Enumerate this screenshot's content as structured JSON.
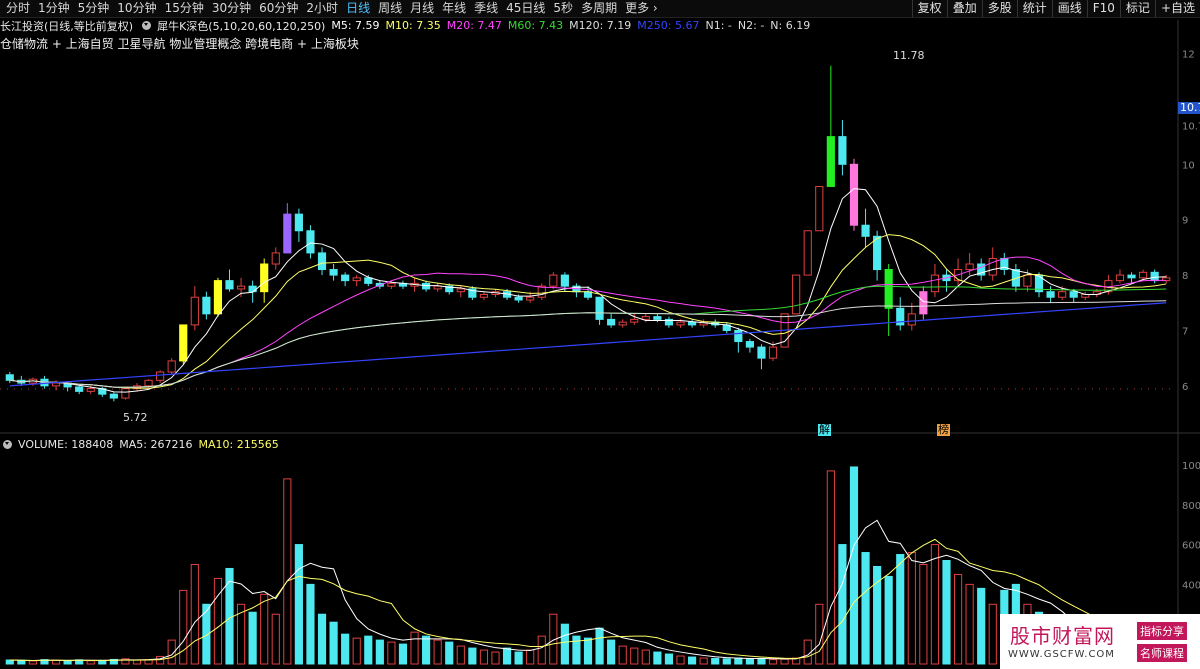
{
  "toolbar": {
    "periods": [
      "分时",
      "1分钟",
      "5分钟",
      "10分钟",
      "15分钟",
      "30分钟",
      "60分钟",
      "2小时",
      "日线",
      "周线",
      "月线",
      "年线",
      "季线",
      "45日线",
      "5秒",
      "多周期",
      "更多"
    ],
    "active_period": "日线",
    "right_buttons": [
      "复权",
      "叠加",
      "多股",
      "统计",
      "画线",
      "F10",
      "标记",
      "+自选"
    ]
  },
  "header": {
    "stock_title": "长江投资(日线,等比前复权)",
    "indicator_name": "犀牛K深色(5,10,20,60,120,250)",
    "ma5": "M5: 7.59",
    "ma10": "M10: 7.35",
    "ma20": "M20: 7.47",
    "ma60": "M60: 7.43",
    "ma120": "M120: 7.19",
    "ma250": "M250: 5.67",
    "n1": "N1: -",
    "n2": "N2: -",
    "n": "N: 6.19"
  },
  "concepts": "仓储物流 + 上海自贸 卫星导航 物业管理概念 跨境电商 + 上海板块",
  "chart_annotations": {
    "high_label": "11.78",
    "low_label": "5.72",
    "marker_1": "解",
    "marker_2": "榜",
    "right_price_tag": "10.7"
  },
  "volume_header": {
    "volume": "VOLUME: 188408",
    "ma5": "MA5: 267216",
    "ma10": "MA10: 215565"
  },
  "watermark": {
    "title": "股市财富网",
    "url": "WWW.GSCFW.COM",
    "tag1": "指标分享",
    "tag2": "名师课程"
  },
  "colors": {
    "up": "#e04040",
    "down": "#4ee8f0",
    "ma5": "#ffffff",
    "ma10": "#ffff66",
    "ma20": "#ff44ff",
    "ma60": "#33dd33",
    "ma120": "#dddddd",
    "ma250": "#3344ff",
    "signal_yellow": "#ffff22",
    "signal_purple": "#9966ff",
    "signal_pink": "#ff77dd",
    "signal_green": "#22ee22"
  },
  "right_axis_price": [
    "12",
    "11",
    "10.7",
    "10",
    "9",
    "8",
    "7",
    "6"
  ],
  "right_axis_volume": [
    "1000",
    "800",
    "600",
    "400",
    "200"
  ],
  "chart_data": {
    "type": "candlestick",
    "candles": [
      {
        "o": 6.2,
        "c": 6.1,
        "h": 6.25,
        "l": 6.05,
        "vol": 20000
      },
      {
        "o": 6.1,
        "c": 6.05,
        "h": 6.18,
        "l": 6.0,
        "vol": 18000
      },
      {
        "o": 6.05,
        "c": 6.12,
        "h": 6.15,
        "l": 6.0,
        "vol": 15000
      },
      {
        "o": 6.12,
        "c": 6.0,
        "h": 6.18,
        "l": 5.95,
        "vol": 22000
      },
      {
        "o": 6.0,
        "c": 6.05,
        "h": 6.1,
        "l": 5.92,
        "vol": 19000
      },
      {
        "o": 6.05,
        "c": 5.98,
        "h": 6.08,
        "l": 5.9,
        "vol": 17000
      },
      {
        "o": 5.98,
        "c": 5.9,
        "h": 6.0,
        "l": 5.85,
        "vol": 21000
      },
      {
        "o": 5.9,
        "c": 5.95,
        "h": 6.0,
        "l": 5.85,
        "vol": 16000
      },
      {
        "o": 5.95,
        "c": 5.85,
        "h": 5.98,
        "l": 5.8,
        "vol": 18000
      },
      {
        "o": 5.85,
        "c": 5.78,
        "h": 5.88,
        "l": 5.72,
        "vol": 23000
      },
      {
        "o": 5.78,
        "c": 5.95,
        "h": 5.98,
        "l": 5.75,
        "vol": 26000
      },
      {
        "o": 5.95,
        "c": 6.0,
        "h": 6.05,
        "l": 5.9,
        "vol": 20000
      },
      {
        "o": 6.0,
        "c": 6.1,
        "h": 6.12,
        "l": 5.96,
        "vol": 22000
      },
      {
        "o": 6.1,
        "c": 6.25,
        "h": 6.28,
        "l": 6.05,
        "vol": 38000
      },
      {
        "o": 6.25,
        "c": 6.45,
        "h": 6.5,
        "l": 6.2,
        "vol": 120000
      },
      {
        "o": 6.45,
        "c": 7.1,
        "h": 7.1,
        "l": 6.4,
        "vol": 370000,
        "sig": "yellow"
      },
      {
        "o": 7.1,
        "c": 7.6,
        "h": 7.8,
        "l": 7.0,
        "vol": 500000
      },
      {
        "o": 7.6,
        "c": 7.3,
        "h": 7.7,
        "l": 7.2,
        "vol": 300000
      },
      {
        "o": 7.3,
        "c": 7.9,
        "h": 7.95,
        "l": 7.25,
        "vol": 430000,
        "sig": "yellow"
      },
      {
        "o": 7.9,
        "c": 7.75,
        "h": 8.1,
        "l": 7.7,
        "vol": 480000
      },
      {
        "o": 7.75,
        "c": 7.8,
        "h": 7.95,
        "l": 7.6,
        "vol": 300000
      },
      {
        "o": 7.8,
        "c": 7.7,
        "h": 7.9,
        "l": 7.5,
        "vol": 260000
      },
      {
        "o": 7.7,
        "c": 8.2,
        "h": 8.3,
        "l": 7.5,
        "vol": 350000,
        "sig": "yellow"
      },
      {
        "o": 8.2,
        "c": 8.4,
        "h": 8.5,
        "l": 8.1,
        "vol": 250000
      },
      {
        "o": 8.4,
        "c": 9.1,
        "h": 9.3,
        "l": 8.4,
        "vol": 930000,
        "sig": "purple"
      },
      {
        "o": 9.1,
        "c": 8.8,
        "h": 9.2,
        "l": 8.6,
        "vol": 600000
      },
      {
        "o": 8.8,
        "c": 8.4,
        "h": 8.9,
        "l": 8.3,
        "vol": 400000
      },
      {
        "o": 8.4,
        "c": 8.1,
        "h": 8.5,
        "l": 8.0,
        "vol": 250000
      },
      {
        "o": 8.1,
        "c": 8.0,
        "h": 8.2,
        "l": 7.9,
        "vol": 210000
      },
      {
        "o": 8.0,
        "c": 7.9,
        "h": 8.05,
        "l": 7.8,
        "vol": 150000
      },
      {
        "o": 7.9,
        "c": 7.95,
        "h": 8.0,
        "l": 7.8,
        "vol": 130000
      },
      {
        "o": 7.95,
        "c": 7.85,
        "h": 8.0,
        "l": 7.8,
        "vol": 140000
      },
      {
        "o": 7.85,
        "c": 7.8,
        "h": 7.9,
        "l": 7.75,
        "vol": 120000
      },
      {
        "o": 7.8,
        "c": 7.85,
        "h": 7.9,
        "l": 7.75,
        "vol": 110000
      },
      {
        "o": 7.85,
        "c": 7.8,
        "h": 7.9,
        "l": 7.75,
        "vol": 100000
      },
      {
        "o": 7.8,
        "c": 7.85,
        "h": 7.95,
        "l": 7.7,
        "vol": 160000
      },
      {
        "o": 7.85,
        "c": 7.75,
        "h": 7.9,
        "l": 7.7,
        "vol": 140000
      },
      {
        "o": 7.75,
        "c": 7.8,
        "h": 7.85,
        "l": 7.7,
        "vol": 120000
      },
      {
        "o": 7.8,
        "c": 7.7,
        "h": 7.85,
        "l": 7.65,
        "vol": 110000
      },
      {
        "o": 7.7,
        "c": 7.75,
        "h": 7.8,
        "l": 7.6,
        "vol": 90000
      },
      {
        "o": 7.75,
        "c": 7.6,
        "h": 7.8,
        "l": 7.55,
        "vol": 80000
      },
      {
        "o": 7.6,
        "c": 7.65,
        "h": 7.7,
        "l": 7.55,
        "vol": 70000
      },
      {
        "o": 7.65,
        "c": 7.7,
        "h": 7.75,
        "l": 7.6,
        "vol": 60000
      },
      {
        "o": 7.7,
        "c": 7.6,
        "h": 7.75,
        "l": 7.55,
        "vol": 80000
      },
      {
        "o": 7.6,
        "c": 7.55,
        "h": 7.65,
        "l": 7.5,
        "vol": 60000
      },
      {
        "o": 7.55,
        "c": 7.6,
        "h": 7.7,
        "l": 7.5,
        "vol": 70000
      },
      {
        "o": 7.6,
        "c": 7.8,
        "h": 7.85,
        "l": 7.55,
        "vol": 140000
      },
      {
        "o": 7.8,
        "c": 8.0,
        "h": 8.05,
        "l": 7.75,
        "vol": 250000
      },
      {
        "o": 8.0,
        "c": 7.8,
        "h": 8.05,
        "l": 7.7,
        "vol": 200000
      },
      {
        "o": 7.8,
        "c": 7.7,
        "h": 7.85,
        "l": 7.6,
        "vol": 140000
      },
      {
        "o": 7.7,
        "c": 7.6,
        "h": 7.8,
        "l": 7.55,
        "vol": 130000
      },
      {
        "o": 7.6,
        "c": 7.2,
        "h": 7.6,
        "l": 7.1,
        "vol": 180000
      },
      {
        "o": 7.2,
        "c": 7.1,
        "h": 7.3,
        "l": 7.05,
        "vol": 120000
      },
      {
        "o": 7.1,
        "c": 7.15,
        "h": 7.2,
        "l": 7.05,
        "vol": 90000
      },
      {
        "o": 7.15,
        "c": 7.2,
        "h": 7.3,
        "l": 7.1,
        "vol": 80000
      },
      {
        "o": 7.2,
        "c": 7.25,
        "h": 7.3,
        "l": 7.15,
        "vol": 70000
      },
      {
        "o": 7.25,
        "c": 7.2,
        "h": 7.3,
        "l": 7.15,
        "vol": 60000
      },
      {
        "o": 7.2,
        "c": 7.1,
        "h": 7.25,
        "l": 7.05,
        "vol": 50000
      },
      {
        "o": 7.1,
        "c": 7.15,
        "h": 7.2,
        "l": 7.05,
        "vol": 40000
      },
      {
        "o": 7.15,
        "c": 7.1,
        "h": 7.2,
        "l": 7.05,
        "vol": 35000
      },
      {
        "o": 7.1,
        "c": 7.15,
        "h": 7.2,
        "l": 7.05,
        "vol": 30000
      },
      {
        "o": 7.15,
        "c": 7.1,
        "h": 7.2,
        "l": 7.05,
        "vol": 28000
      },
      {
        "o": 7.1,
        "c": 7.0,
        "h": 7.15,
        "l": 6.95,
        "vol": 26000
      },
      {
        "o": 7.0,
        "c": 6.8,
        "h": 7.05,
        "l": 6.6,
        "vol": 30000
      },
      {
        "o": 6.8,
        "c": 6.7,
        "h": 6.85,
        "l": 6.6,
        "vol": 25000
      },
      {
        "o": 6.7,
        "c": 6.5,
        "h": 6.75,
        "l": 6.3,
        "vol": 28000
      },
      {
        "o": 6.5,
        "c": 6.7,
        "h": 6.8,
        "l": 6.45,
        "vol": 22000
      },
      {
        "o": 6.7,
        "c": 7.3,
        "h": 7.3,
        "l": 6.7,
        "vol": 24000
      },
      {
        "o": 7.3,
        "c": 8.0,
        "h": 8.0,
        "l": 7.3,
        "vol": 30000
      },
      {
        "o": 8.0,
        "c": 8.8,
        "h": 8.8,
        "l": 8.0,
        "vol": 120000
      },
      {
        "o": 8.8,
        "c": 9.6,
        "h": 9.6,
        "l": 8.8,
        "vol": 300000
      },
      {
        "o": 9.6,
        "c": 10.5,
        "h": 11.78,
        "l": 9.6,
        "vol": 970000,
        "sig": "green"
      },
      {
        "o": 10.5,
        "c": 10.0,
        "h": 10.8,
        "l": 9.8,
        "vol": 600000
      },
      {
        "o": 10.0,
        "c": 8.9,
        "h": 10.1,
        "l": 8.8,
        "vol": 990000,
        "sig": "pink"
      },
      {
        "o": 8.9,
        "c": 8.7,
        "h": 9.2,
        "l": 8.5,
        "vol": 560000
      },
      {
        "o": 8.7,
        "c": 8.1,
        "h": 8.8,
        "l": 7.9,
        "vol": 490000
      },
      {
        "o": 8.1,
        "c": 7.4,
        "h": 8.2,
        "l": 6.9,
        "vol": 440000,
        "sig": "green"
      },
      {
        "o": 7.4,
        "c": 7.1,
        "h": 7.6,
        "l": 7.0,
        "vol": 550000
      },
      {
        "o": 7.1,
        "c": 7.3,
        "h": 7.5,
        "l": 7.0,
        "vol": 560000
      },
      {
        "o": 7.3,
        "c": 7.7,
        "h": 7.8,
        "l": 7.2,
        "vol": 500000,
        "sig": "pink"
      },
      {
        "o": 7.7,
        "c": 8.0,
        "h": 8.2,
        "l": 7.6,
        "vol": 600000
      },
      {
        "o": 8.0,
        "c": 7.9,
        "h": 8.1,
        "l": 7.7,
        "vol": 520000
      },
      {
        "o": 7.9,
        "c": 8.1,
        "h": 8.3,
        "l": 7.8,
        "vol": 450000
      },
      {
        "o": 8.1,
        "c": 8.2,
        "h": 8.4,
        "l": 8.0,
        "vol": 400000
      },
      {
        "o": 8.2,
        "c": 8.0,
        "h": 8.3,
        "l": 7.9,
        "vol": 380000
      },
      {
        "o": 8.0,
        "c": 8.3,
        "h": 8.5,
        "l": 7.9,
        "vol": 300000
      },
      {
        "o": 8.3,
        "c": 8.1,
        "h": 8.4,
        "l": 8.0,
        "vol": 370000
      },
      {
        "o": 8.1,
        "c": 7.8,
        "h": 8.2,
        "l": 7.7,
        "vol": 400000
      },
      {
        "o": 7.8,
        "c": 8.0,
        "h": 8.1,
        "l": 7.7,
        "vol": 300000
      },
      {
        "o": 8.0,
        "c": 7.7,
        "h": 8.05,
        "l": 7.6,
        "vol": 260000
      },
      {
        "o": 7.7,
        "c": 7.6,
        "h": 7.8,
        "l": 7.5,
        "vol": 200000
      },
      {
        "o": 7.6,
        "c": 7.7,
        "h": 7.8,
        "l": 7.55,
        "vol": 160000
      },
      {
        "o": 7.7,
        "c": 7.6,
        "h": 7.75,
        "l": 7.5,
        "vol": 140000
      },
      {
        "o": 7.6,
        "c": 7.65,
        "h": 7.7,
        "l": 7.55,
        "vol": 100000
      },
      {
        "o": 7.65,
        "c": 7.7,
        "h": 7.75,
        "l": 7.6,
        "vol": 80000
      },
      {
        "o": 7.7,
        "c": 7.9,
        "h": 8.0,
        "l": 7.65,
        "vol": 60000
      },
      {
        "o": 7.9,
        "c": 8.0,
        "h": 8.1,
        "l": 7.85,
        "vol": 190000
      },
      {
        "o": 8.0,
        "c": 7.95,
        "h": 8.05,
        "l": 7.85,
        "vol": 120000
      },
      {
        "o": 7.95,
        "c": 8.05,
        "h": 8.1,
        "l": 7.9,
        "vol": 110000
      },
      {
        "o": 8.05,
        "c": 7.9,
        "h": 8.1,
        "l": 7.85,
        "vol": 130000
      },
      {
        "o": 7.9,
        "c": 7.95,
        "h": 8.0,
        "l": 7.85,
        "vol": 90000
      }
    ],
    "price_range": [
      5.6,
      12.1
    ],
    "volume_range": [
      0,
      1050000
    ]
  }
}
